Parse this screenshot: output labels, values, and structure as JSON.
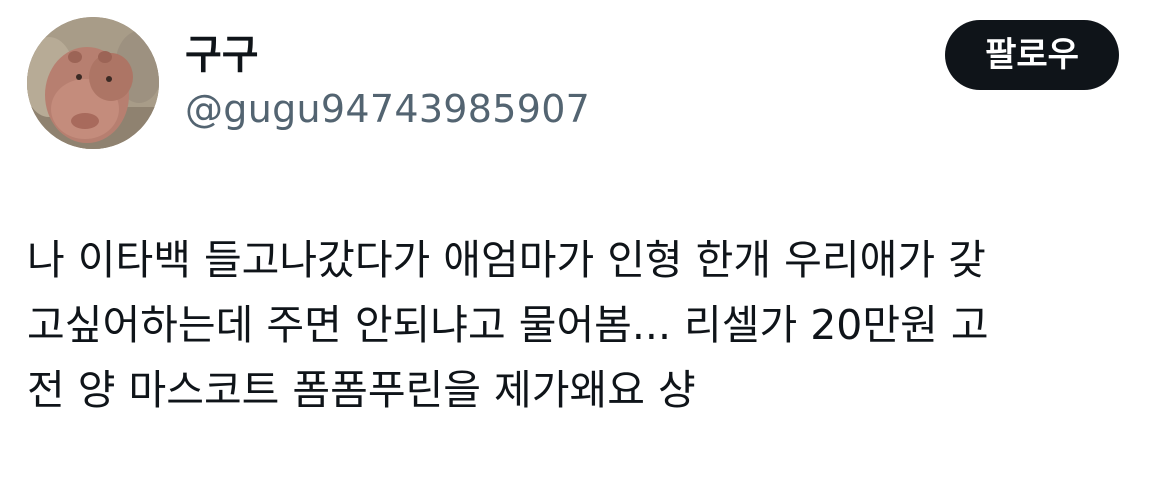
{
  "author": {
    "display_name": "구구",
    "handle": "@gugu94743985907",
    "avatar_icon": "pygmy-hippo-avatar"
  },
  "actions": {
    "follow_label": "팔로우"
  },
  "tweet": {
    "lines": [
      "나 이타백 들고나갔다가 애엄마가 인형 한개 우리애가 갖",
      "고싶어하는데 주면 안되냐고 물어봄... 리셀가 20만원 고",
      "전 양 마스코트 폼폼푸린을 제가왜요 샹"
    ]
  },
  "colors": {
    "text_primary": "#0f1419",
    "text_secondary": "#536471",
    "button_bg": "#0f1419",
    "button_text": "#ffffff"
  }
}
